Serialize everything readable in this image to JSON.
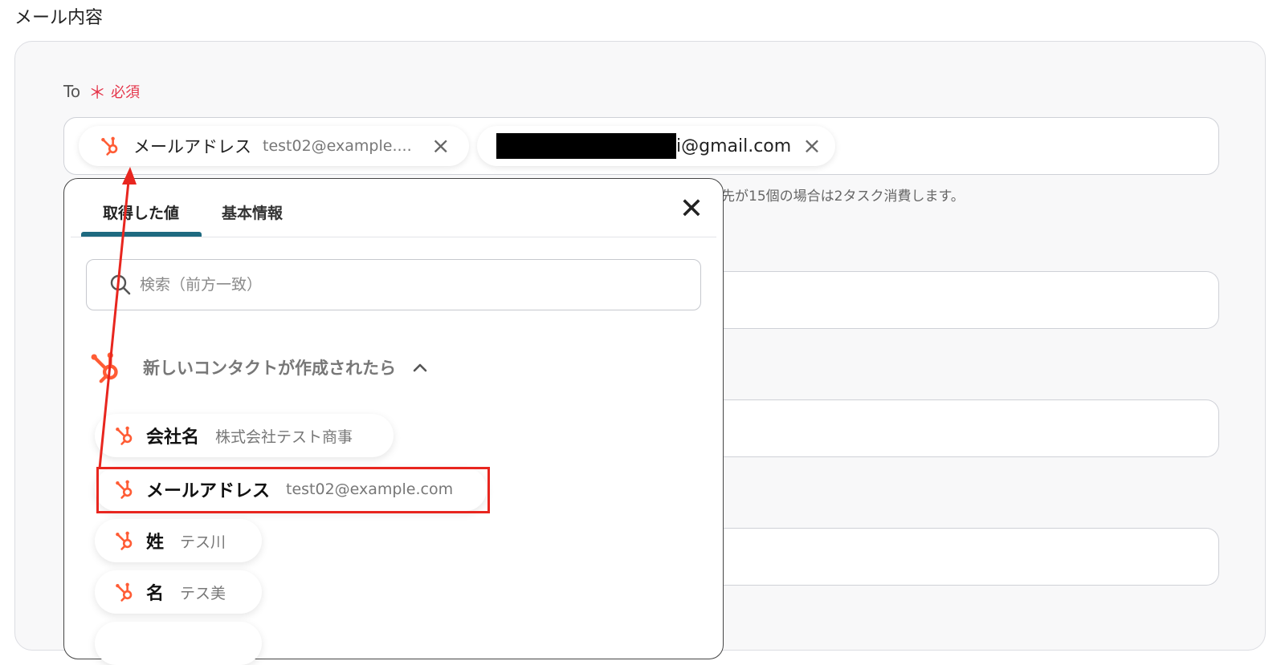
{
  "section_title": "メール内容",
  "to_field": {
    "label": "To",
    "required_marker": "＊",
    "required_text": "必須",
    "chips": [
      {
        "label": "メールアドレス",
        "value": "test02@example...."
      },
      {
        "email_suffix": "i@gmail.com"
      }
    ],
    "hint": "先が15個の場合は2タスク消費します。"
  },
  "popup": {
    "tabs": [
      "取得した値",
      "基本情報"
    ],
    "active_tab": "取得した値",
    "search_placeholder": "検索（前方一致）",
    "group_title": "新しいコンタクトが作成されたら",
    "items": [
      {
        "label": "会社名",
        "value": "株式会社テスト商事"
      },
      {
        "label": "メールアドレス",
        "value": "test02@example.com"
      },
      {
        "label": "姓",
        "value": "テス川"
      },
      {
        "label": "名",
        "value": "テス美"
      }
    ]
  },
  "colors": {
    "hubspot_orange": "#ff5c35",
    "required_red": "#e5374c",
    "tab_accent": "#1e6a80",
    "annotation_red": "#e8261f"
  },
  "icons": {
    "chip_close": "close-icon",
    "popup_close": "close-icon",
    "search": "search-icon",
    "source": "hubspot-icon",
    "group_toggle": "chevron-up-icon"
  }
}
